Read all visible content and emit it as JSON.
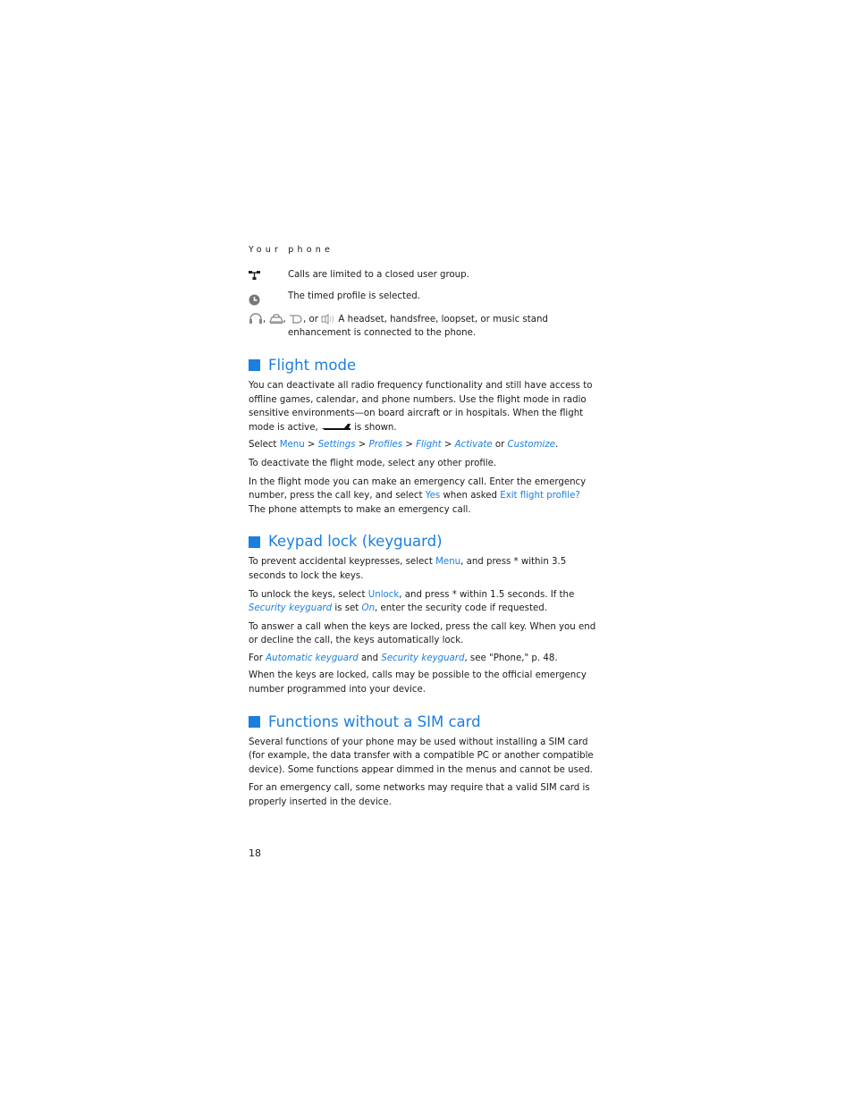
{
  "header": {
    "running_head": "Your phone"
  },
  "indicators": [
    {
      "icon": "closed-user-group-icon",
      "text": "Calls are limited to a closed user group."
    },
    {
      "icon": "timed-profile-icon",
      "text": "The timed profile is selected."
    }
  ],
  "enhancements": {
    "icons": [
      "headset-icon",
      "handsfree-icon",
      "loopset-icon",
      "music-stand-icon"
    ],
    "sep1": ",",
    "sep2": ",",
    "sep3": ", or",
    "text_line1": "A headset, handsfree, loopset, or music stand",
    "text_line2": "enhancement is connected to the phone."
  },
  "sections": {
    "flight": {
      "title": "Flight mode",
      "p1_before_icon": "You can deactivate all radio frequency functionality and still have access to offline games, calendar, and phone numbers. Use the flight mode in radio sensitive environments—on board aircraft or in hospitals. When the flight mode is active,",
      "p1_after_icon": "is shown.",
      "p1_icon": "airplane-icon",
      "path": {
        "prefix": "Select",
        "menu": "Menu",
        "sep": ">",
        "settings": "Settings",
        "profiles": "Profiles",
        "flight": "Flight",
        "activate": "Activate",
        "or": "or",
        "customize": "Customize",
        "end": "."
      },
      "p3": "To deactivate the flight mode, select any other profile.",
      "p4": {
        "a": "In the flight mode you can make an emergency call. Enter the emergency number, press the call key, and select",
        "yes": "Yes",
        "b": "when asked",
        "exit": "Exit flight profile?",
        "c": "The phone attempts to make an emergency call."
      }
    },
    "keypad": {
      "title": "Keypad lock (keyguard)",
      "p1": {
        "a": "To prevent accidental keypresses, select",
        "menu": "Menu",
        "b": ", and press * within 3.5 seconds to lock the keys."
      },
      "p2": {
        "a": "To unlock the keys, select",
        "unlock": "Unlock",
        "b": ", and press * within 1.5 seconds. If the",
        "security": "Security keyguard",
        "c": "is set",
        "on": "On",
        "d": ", enter the security code if requested."
      },
      "p3": "To answer a call when the keys are locked, press the call key. When you end or decline the call, the keys automatically lock.",
      "p4": {
        "a": "For",
        "auto": "Automatic keyguard",
        "b": "and",
        "security": "Security keyguard",
        "c": ", see \"Phone,\" p. 48."
      },
      "p5": "When the keys are locked, calls may be possible to the official emergency number programmed into your device."
    },
    "sim": {
      "title": "Functions without a SIM card",
      "p1": "Several functions of your phone may be used without installing a SIM card (for example, the data transfer with a compatible PC or another compatible device). Some functions appear dimmed in the menus and cannot be used.",
      "p2": "For an emergency call, some networks may require that a valid SIM card is properly inserted in the device."
    }
  },
  "footer": {
    "page_number": "18"
  },
  "colors": {
    "accent": "#1a7fe0",
    "text": "#1a1a1a"
  }
}
